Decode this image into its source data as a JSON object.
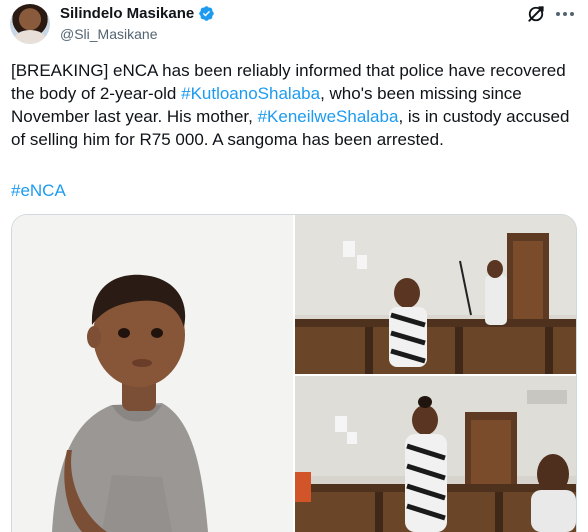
{
  "author": {
    "display_name": "Silindelo Masikane",
    "handle": "@Sli_Masikane",
    "verified": true,
    "avatar_icon": "avatar-photo"
  },
  "actions": {
    "grok_icon": "grok-icon",
    "more_icon": "more-dots-icon"
  },
  "tweet": {
    "segments": [
      {
        "type": "text",
        "value": "[BREAKING] eNCA has been reliably informed that police have recovered the body of 2-year-old "
      },
      {
        "type": "hashtag",
        "value": "#KutloanoShalaba"
      },
      {
        "type": "text",
        "value": ", who's been missing since November last year. His mother, "
      },
      {
        "type": "hashtag",
        "value": "#KeneilweShalaba"
      },
      {
        "type": "text",
        "value": ", is in custody accused of selling him for R75 000. A sangoma has been arrested."
      }
    ],
    "trailing_hashtag": "#eNCA"
  },
  "media": {
    "photos": [
      {
        "name": "photo-child",
        "desc_icon": "child-portrait-photo"
      },
      {
        "name": "photo-court-top",
        "desc_icon": "courtroom-photo"
      },
      {
        "name": "photo-court-bottom",
        "desc_icon": "courtroom-photo"
      }
    ]
  },
  "colors": {
    "text": "#0f1419",
    "secondary": "#536471",
    "link": "#1d9bf0",
    "border": "#cfd9de",
    "verified_badge": "#1d9bf0"
  }
}
